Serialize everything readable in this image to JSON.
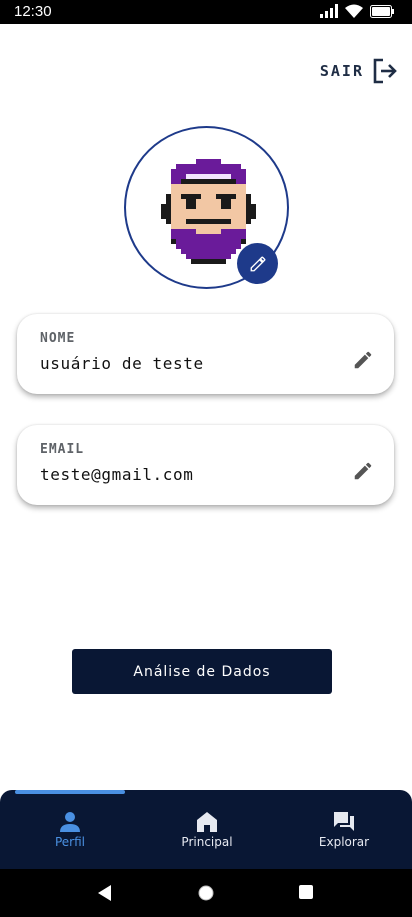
{
  "status_bar": {
    "time": "12:30"
  },
  "header": {
    "logout_label": "SAIR"
  },
  "fields": {
    "name": {
      "label": "NOME",
      "value": "usuário de teste"
    },
    "email": {
      "label": "EMAIL",
      "value": "teste@gmail.com"
    }
  },
  "actions": {
    "data_analysis_label": "Análise de Dados"
  },
  "bottom_nav": {
    "items": [
      {
        "label": "Perfil",
        "icon": "person-icon",
        "active": true
      },
      {
        "label": "Principal",
        "icon": "home-icon",
        "active": false
      },
      {
        "label": "Explorar",
        "icon": "chat-icon",
        "active": false
      }
    ]
  },
  "colors": {
    "primary_dark": "#091734",
    "accent_blue": "#1e3a8a",
    "active_nav": "#4a90e2",
    "inactive_nav": "#e6e9f0"
  }
}
